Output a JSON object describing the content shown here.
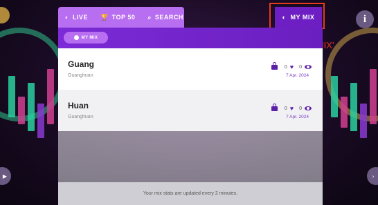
{
  "nav": {
    "live": "LIVE",
    "top50": "TOP 50",
    "search": "SEARCH",
    "mymix": "MY MIX"
  },
  "annotation": {
    "text": "点击‘MY MIX’",
    "color": "#e8321a"
  },
  "panel": {
    "chip_label": "MY MIX",
    "mixes": [
      {
        "title": "Guang",
        "subtitle": "Guanghuan",
        "likes": "0",
        "views": "0",
        "date": "7 Apr. 2024"
      },
      {
        "title": "Huan",
        "subtitle": "Guanghuan",
        "likes": "0",
        "views": "0",
        "date": "7 Apr. 2024"
      }
    ],
    "footer": "Your mix stats are updated every 2 minutes."
  },
  "colors": {
    "accent": "#b86ef0",
    "active": "#6d1fc4",
    "icon": "#5b1fa8"
  },
  "icons": {
    "live": "half-circle-icon",
    "top50": "trophy-icon",
    "search": "search-icon",
    "mymix": "half-circle-icon",
    "private": "lock-icon",
    "likes": "heart-icon",
    "views": "eye-icon",
    "info": "info-icon"
  }
}
